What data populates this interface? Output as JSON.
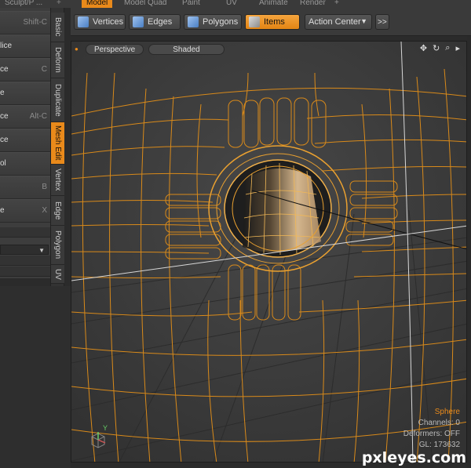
{
  "topbar": {
    "tabs": [
      {
        "label": "Sculpt/P ...",
        "active": false
      },
      {
        "label": "Model",
        "active": true
      },
      {
        "label": "Model Quad",
        "active": false
      },
      {
        "label": "Paint",
        "active": false
      },
      {
        "label": "UV",
        "active": false
      },
      {
        "label": "Animate",
        "active": false
      },
      {
        "label": "Render",
        "active": false
      }
    ],
    "add_label": "+"
  },
  "tools": {
    "items": [
      {
        "label": "",
        "shortcut": "Shift-C"
      },
      {
        "label": "lice",
        "shortcut": ""
      },
      {
        "label": "ce",
        "shortcut": "C"
      },
      {
        "label": "e",
        "shortcut": ""
      },
      {
        "label": "ce",
        "shortcut": "Alt-C"
      },
      {
        "label": "ce",
        "shortcut": ""
      },
      {
        "label": "ol",
        "shortcut": ""
      },
      {
        "label": "",
        "shortcut": "B"
      },
      {
        "label": "e",
        "shortcut": "X"
      }
    ]
  },
  "vtabs": [
    {
      "label": "Basic",
      "active": false
    },
    {
      "label": "Deform",
      "active": false
    },
    {
      "label": "Duplicate",
      "active": false
    },
    {
      "label": "Mesh Edit",
      "active": true
    },
    {
      "label": "Vertex",
      "active": false
    },
    {
      "label": "Edge",
      "active": false
    },
    {
      "label": "Polygon",
      "active": false
    },
    {
      "label": "UV",
      "active": false
    }
  ],
  "toolbar": {
    "vertices": "Vertices",
    "edges": "Edges",
    "polygons": "Polygons",
    "items": "Items",
    "action_center": "Action Center",
    "more": ">>"
  },
  "viewport": {
    "view_mode": "Perspective",
    "shading": "Shaded",
    "info": {
      "object": "Sphere",
      "channels": "Channels: 0",
      "deformers": "Deformers: OFF",
      "gl": "GL: 173632"
    },
    "axis_label": "Y"
  },
  "watermark": "pxleyes.com",
  "colors": {
    "accent": "#e98a1b",
    "wire": "#e0961e",
    "background": "#3b3b3b"
  }
}
